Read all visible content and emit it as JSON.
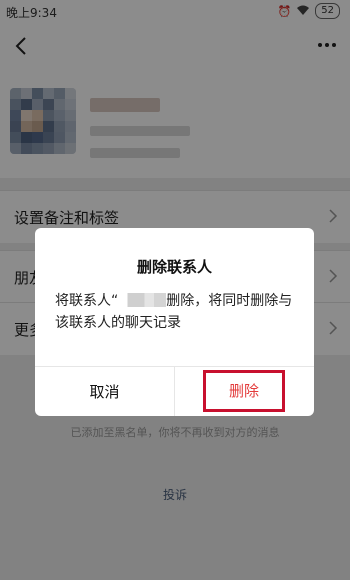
{
  "status": {
    "time": "晚上9:34",
    "battery": "52"
  },
  "menu": {
    "items": [
      {
        "label": "设置备注和标签"
      },
      {
        "label": "朋友"
      },
      {
        "label": "更多"
      }
    ]
  },
  "footer": {
    "blacklist_note": "已添加至黑名单，你将不再收到对方的消息",
    "report_label": "投诉"
  },
  "dialog": {
    "title": "删除联系人",
    "message_prefix": "将联系人“",
    "message_suffix": "删除，将同时删除与该联系人的聊天记录",
    "cancel_label": "取消",
    "delete_label": "删除"
  },
  "colors": {
    "accent_red": "#e33b3b",
    "highlight_border": "#c8102e",
    "overlay": "rgba(0,0,0,0.45)"
  },
  "icons": {
    "back": "chevron-left-icon",
    "more": "more-dots-icon",
    "alarm": "alarm-icon",
    "wifi": "wifi-icon",
    "battery": "battery-icon"
  }
}
